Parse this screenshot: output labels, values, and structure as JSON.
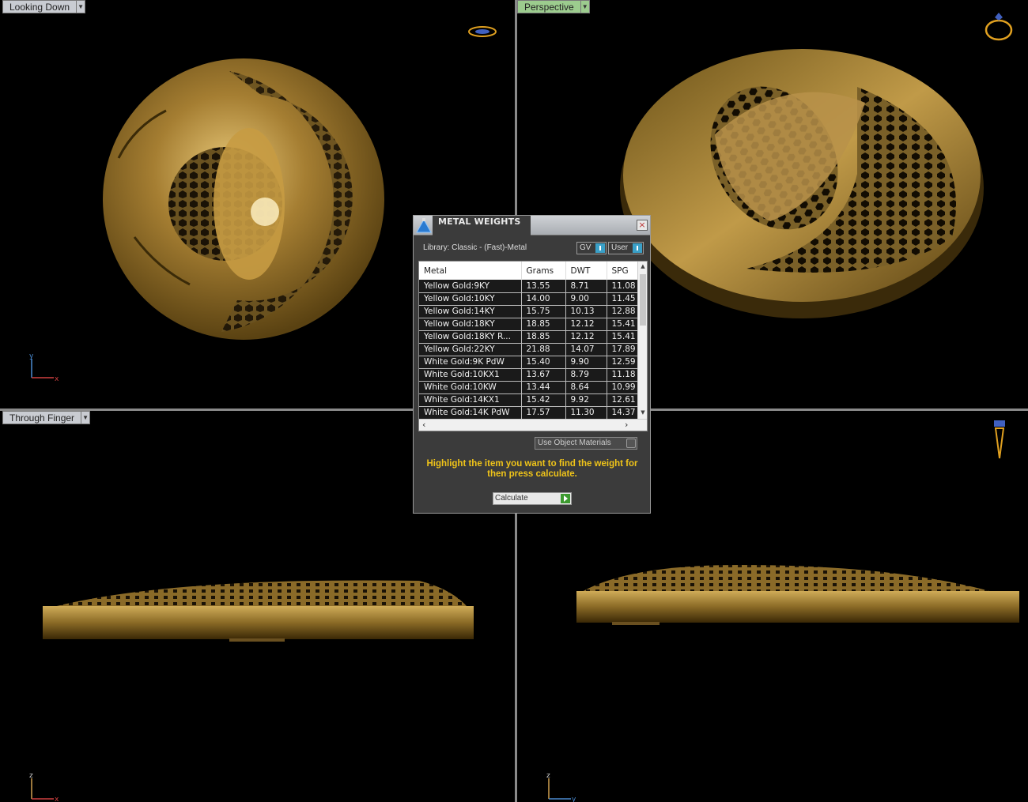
{
  "viewports": {
    "top_left": {
      "label": "Looking Down",
      "axis": {
        "vertical": "y",
        "horizontal": "x"
      }
    },
    "top_right": {
      "label": "Perspective"
    },
    "bottom_left": {
      "label": "Through Finger",
      "axis": {
        "vertical": "z",
        "horizontal": "x"
      }
    },
    "bottom_right": {
      "axis": {
        "vertical": "z",
        "horizontal": "y"
      }
    }
  },
  "dialog": {
    "title": "METAL WEIGHTS",
    "library": "Library: Classic - (Fast)-Metal",
    "gv_label": "GV",
    "user_label": "User",
    "columns": [
      "Metal",
      "Grams",
      "DWT",
      "SPG"
    ],
    "rows": [
      [
        "Yellow Gold:9KY",
        "13.55",
        "8.71",
        "11.08"
      ],
      [
        "Yellow Gold:10KY",
        "14.00",
        "9.00",
        "11.45"
      ],
      [
        "Yellow Gold:14KY",
        "15.75",
        "10.13",
        "12.88"
      ],
      [
        "Yellow Gold:18KY",
        "18.85",
        "12.12",
        "15.41"
      ],
      [
        "Yellow Gold:18KY R...",
        "18.85",
        "12.12",
        "15.41"
      ],
      [
        "Yellow Gold:22KY",
        "21.88",
        "14.07",
        "17.89"
      ],
      [
        "White Gold:9K PdW",
        "15.40",
        "9.90",
        "12.59"
      ],
      [
        "White Gold:10KX1",
        "13.67",
        "8.79",
        "11.18"
      ],
      [
        "White Gold:10KW",
        "13.44",
        "8.64",
        "10.99"
      ],
      [
        "White Gold:14KX1",
        "15.42",
        "9.92",
        "12.61"
      ],
      [
        "White Gold:14K PdW",
        "17.57",
        "11.30",
        "14.37"
      ]
    ],
    "use_object_materials": "Use Object Materials",
    "hint": "Highlight the item you want to find the weight for then press calculate.",
    "calculate_label": "Calculate"
  },
  "colors": {
    "gold": "#b08a3a",
    "hint_yellow": "#f0c419",
    "dialog_bg": "#3b3b3b"
  }
}
